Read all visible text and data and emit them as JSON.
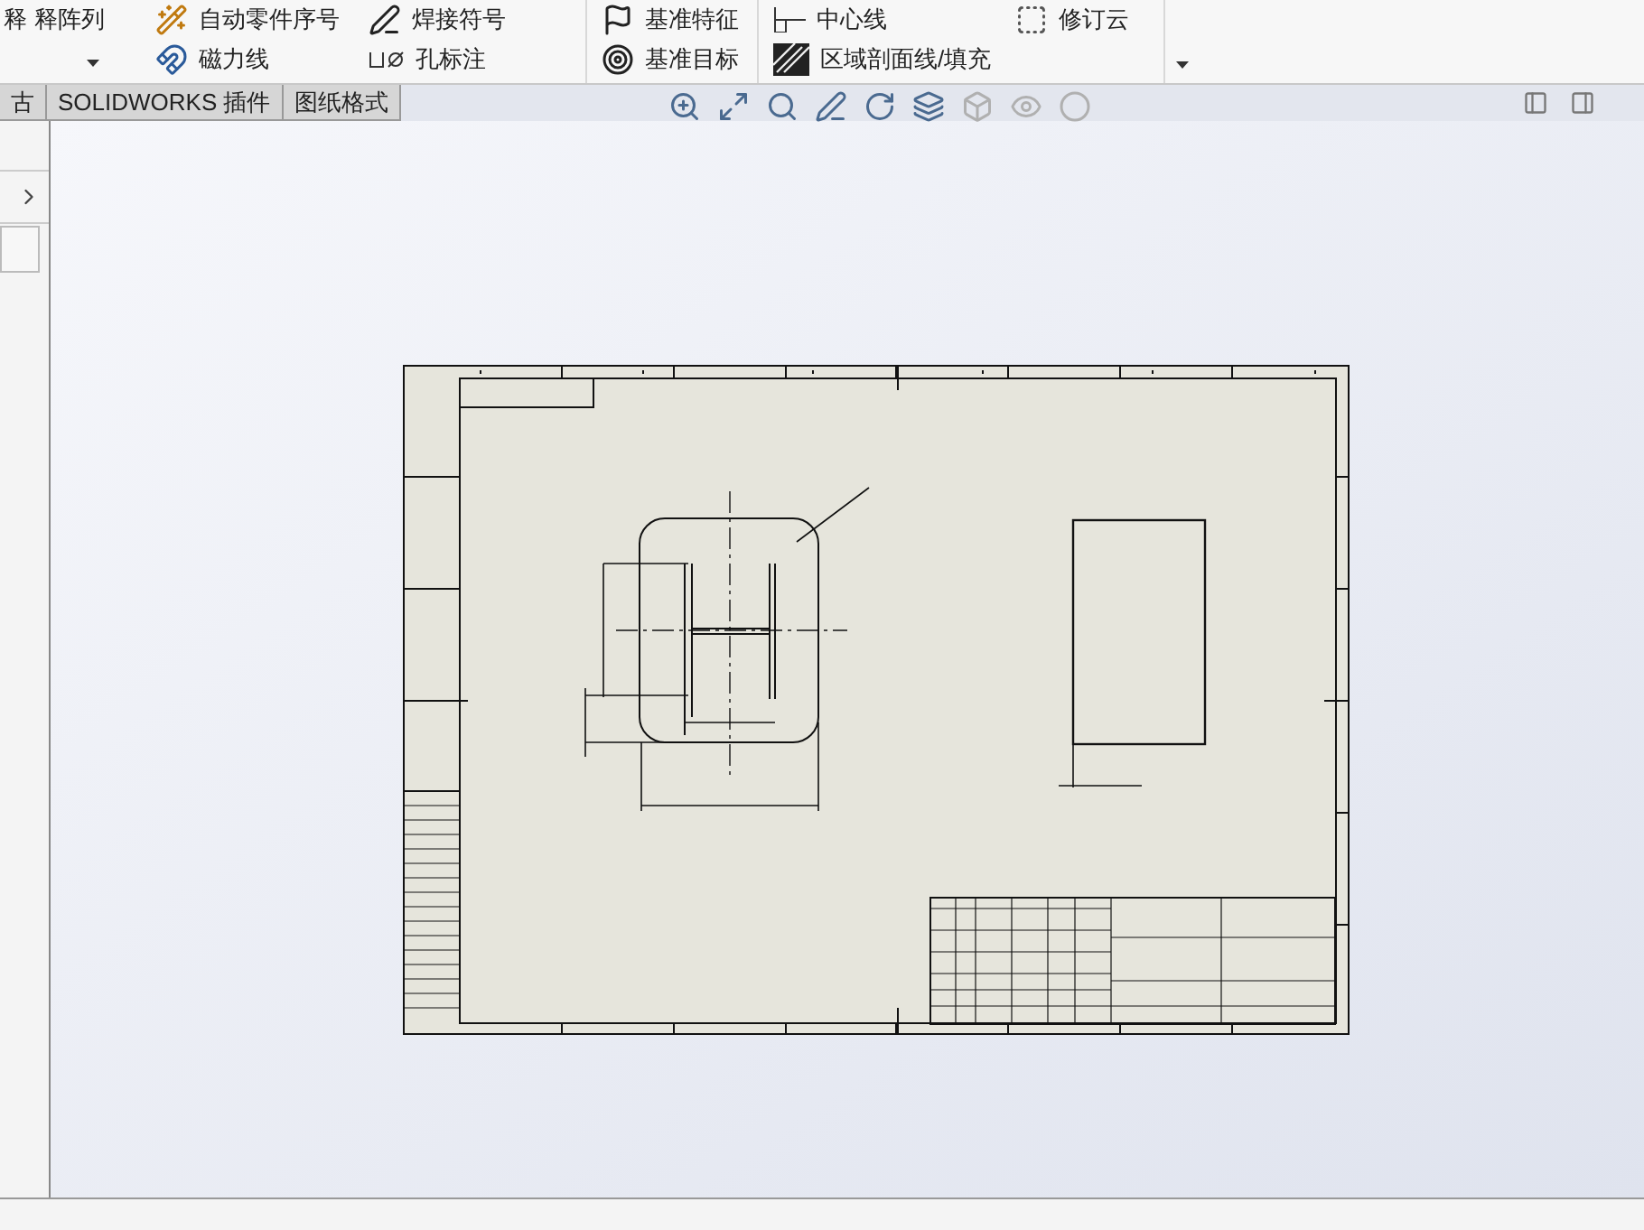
{
  "ribbon": {
    "columns": [
      {
        "items": [
          {
            "label": "释"
          },
          {
            "label": "释阵列"
          }
        ]
      },
      {
        "items": [
          {
            "label": "自动零件序号"
          },
          {
            "label": "磁力线"
          }
        ]
      },
      {
        "items": [
          {
            "label": "焊接符号"
          },
          {
            "label": "孔标注"
          }
        ]
      },
      {
        "items": [
          {
            "label": "基准特征"
          },
          {
            "label": "基准目标"
          }
        ]
      },
      {
        "items": [
          {
            "label": "中心线"
          },
          {
            "label": "区域剖面线/填充"
          }
        ]
      },
      {
        "items": [
          {
            "label": "修订云"
          }
        ]
      }
    ]
  },
  "tabs": [
    {
      "label": "古"
    },
    {
      "label": "SOLIDWORKS 插件"
    },
    {
      "label": "图纸格式"
    }
  ]
}
